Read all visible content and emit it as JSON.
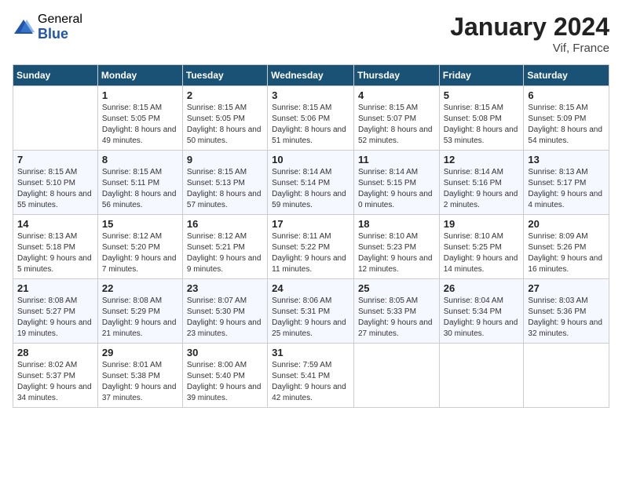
{
  "logo": {
    "general": "General",
    "blue": "Blue"
  },
  "title": "January 2024",
  "location": "Vif, France",
  "weekdays": [
    "Sunday",
    "Monday",
    "Tuesday",
    "Wednesday",
    "Thursday",
    "Friday",
    "Saturday"
  ],
  "weeks": [
    [
      {
        "day": "",
        "sunrise": "",
        "sunset": "",
        "daylight": ""
      },
      {
        "day": "1",
        "sunrise": "Sunrise: 8:15 AM",
        "sunset": "Sunset: 5:05 PM",
        "daylight": "Daylight: 8 hours and 49 minutes."
      },
      {
        "day": "2",
        "sunrise": "Sunrise: 8:15 AM",
        "sunset": "Sunset: 5:05 PM",
        "daylight": "Daylight: 8 hours and 50 minutes."
      },
      {
        "day": "3",
        "sunrise": "Sunrise: 8:15 AM",
        "sunset": "Sunset: 5:06 PM",
        "daylight": "Daylight: 8 hours and 51 minutes."
      },
      {
        "day": "4",
        "sunrise": "Sunrise: 8:15 AM",
        "sunset": "Sunset: 5:07 PM",
        "daylight": "Daylight: 8 hours and 52 minutes."
      },
      {
        "day": "5",
        "sunrise": "Sunrise: 8:15 AM",
        "sunset": "Sunset: 5:08 PM",
        "daylight": "Daylight: 8 hours and 53 minutes."
      },
      {
        "day": "6",
        "sunrise": "Sunrise: 8:15 AM",
        "sunset": "Sunset: 5:09 PM",
        "daylight": "Daylight: 8 hours and 54 minutes."
      }
    ],
    [
      {
        "day": "7",
        "sunrise": "Sunrise: 8:15 AM",
        "sunset": "Sunset: 5:10 PM",
        "daylight": "Daylight: 8 hours and 55 minutes."
      },
      {
        "day": "8",
        "sunrise": "Sunrise: 8:15 AM",
        "sunset": "Sunset: 5:11 PM",
        "daylight": "Daylight: 8 hours and 56 minutes."
      },
      {
        "day": "9",
        "sunrise": "Sunrise: 8:15 AM",
        "sunset": "Sunset: 5:13 PM",
        "daylight": "Daylight: 8 hours and 57 minutes."
      },
      {
        "day": "10",
        "sunrise": "Sunrise: 8:14 AM",
        "sunset": "Sunset: 5:14 PM",
        "daylight": "Daylight: 8 hours and 59 minutes."
      },
      {
        "day": "11",
        "sunrise": "Sunrise: 8:14 AM",
        "sunset": "Sunset: 5:15 PM",
        "daylight": "Daylight: 9 hours and 0 minutes."
      },
      {
        "day": "12",
        "sunrise": "Sunrise: 8:14 AM",
        "sunset": "Sunset: 5:16 PM",
        "daylight": "Daylight: 9 hours and 2 minutes."
      },
      {
        "day": "13",
        "sunrise": "Sunrise: 8:13 AM",
        "sunset": "Sunset: 5:17 PM",
        "daylight": "Daylight: 9 hours and 4 minutes."
      }
    ],
    [
      {
        "day": "14",
        "sunrise": "Sunrise: 8:13 AM",
        "sunset": "Sunset: 5:18 PM",
        "daylight": "Daylight: 9 hours and 5 minutes."
      },
      {
        "day": "15",
        "sunrise": "Sunrise: 8:12 AM",
        "sunset": "Sunset: 5:20 PM",
        "daylight": "Daylight: 9 hours and 7 minutes."
      },
      {
        "day": "16",
        "sunrise": "Sunrise: 8:12 AM",
        "sunset": "Sunset: 5:21 PM",
        "daylight": "Daylight: 9 hours and 9 minutes."
      },
      {
        "day": "17",
        "sunrise": "Sunrise: 8:11 AM",
        "sunset": "Sunset: 5:22 PM",
        "daylight": "Daylight: 9 hours and 11 minutes."
      },
      {
        "day": "18",
        "sunrise": "Sunrise: 8:10 AM",
        "sunset": "Sunset: 5:23 PM",
        "daylight": "Daylight: 9 hours and 12 minutes."
      },
      {
        "day": "19",
        "sunrise": "Sunrise: 8:10 AM",
        "sunset": "Sunset: 5:25 PM",
        "daylight": "Daylight: 9 hours and 14 minutes."
      },
      {
        "day": "20",
        "sunrise": "Sunrise: 8:09 AM",
        "sunset": "Sunset: 5:26 PM",
        "daylight": "Daylight: 9 hours and 16 minutes."
      }
    ],
    [
      {
        "day": "21",
        "sunrise": "Sunrise: 8:08 AM",
        "sunset": "Sunset: 5:27 PM",
        "daylight": "Daylight: 9 hours and 19 minutes."
      },
      {
        "day": "22",
        "sunrise": "Sunrise: 8:08 AM",
        "sunset": "Sunset: 5:29 PM",
        "daylight": "Daylight: 9 hours and 21 minutes."
      },
      {
        "day": "23",
        "sunrise": "Sunrise: 8:07 AM",
        "sunset": "Sunset: 5:30 PM",
        "daylight": "Daylight: 9 hours and 23 minutes."
      },
      {
        "day": "24",
        "sunrise": "Sunrise: 8:06 AM",
        "sunset": "Sunset: 5:31 PM",
        "daylight": "Daylight: 9 hours and 25 minutes."
      },
      {
        "day": "25",
        "sunrise": "Sunrise: 8:05 AM",
        "sunset": "Sunset: 5:33 PM",
        "daylight": "Daylight: 9 hours and 27 minutes."
      },
      {
        "day": "26",
        "sunrise": "Sunrise: 8:04 AM",
        "sunset": "Sunset: 5:34 PM",
        "daylight": "Daylight: 9 hours and 30 minutes."
      },
      {
        "day": "27",
        "sunrise": "Sunrise: 8:03 AM",
        "sunset": "Sunset: 5:36 PM",
        "daylight": "Daylight: 9 hours and 32 minutes."
      }
    ],
    [
      {
        "day": "28",
        "sunrise": "Sunrise: 8:02 AM",
        "sunset": "Sunset: 5:37 PM",
        "daylight": "Daylight: 9 hours and 34 minutes."
      },
      {
        "day": "29",
        "sunrise": "Sunrise: 8:01 AM",
        "sunset": "Sunset: 5:38 PM",
        "daylight": "Daylight: 9 hours and 37 minutes."
      },
      {
        "day": "30",
        "sunrise": "Sunrise: 8:00 AM",
        "sunset": "Sunset: 5:40 PM",
        "daylight": "Daylight: 9 hours and 39 minutes."
      },
      {
        "day": "31",
        "sunrise": "Sunrise: 7:59 AM",
        "sunset": "Sunset: 5:41 PM",
        "daylight": "Daylight: 9 hours and 42 minutes."
      },
      {
        "day": "",
        "sunrise": "",
        "sunset": "",
        "daylight": ""
      },
      {
        "day": "",
        "sunrise": "",
        "sunset": "",
        "daylight": ""
      },
      {
        "day": "",
        "sunrise": "",
        "sunset": "",
        "daylight": ""
      }
    ]
  ]
}
